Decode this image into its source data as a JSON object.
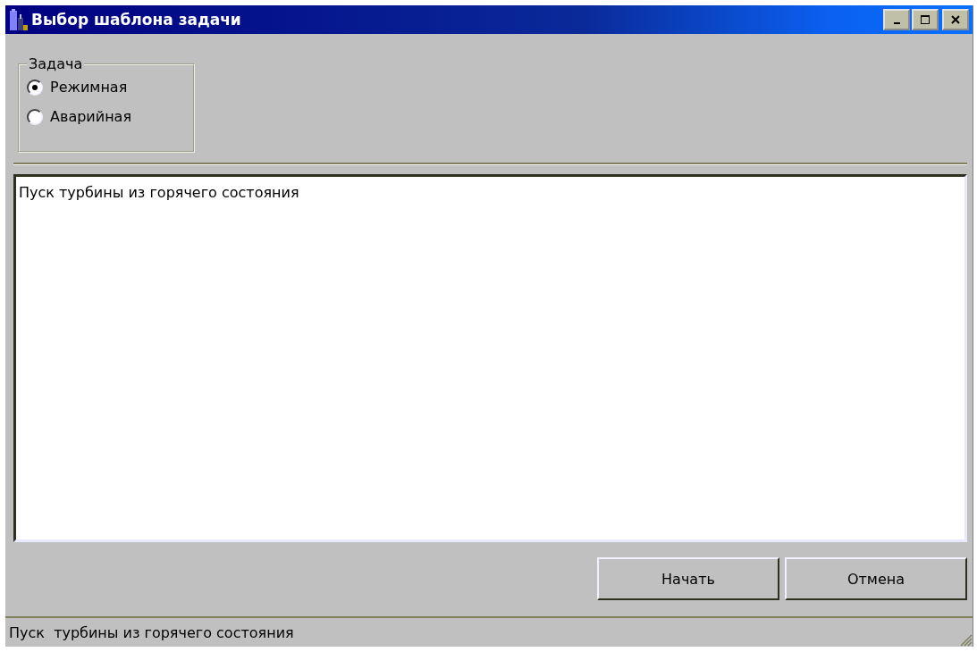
{
  "window": {
    "title": "Выбор шаблона задачи"
  },
  "task_group": {
    "legend": "Задача",
    "options": [
      {
        "label": "Режимная",
        "selected": true
      },
      {
        "label": "Аварийная",
        "selected": false
      }
    ]
  },
  "list": {
    "items": [
      "Пуск турбины из горячего состояния"
    ]
  },
  "buttons": [
    "Начать",
    "Отмена"
  ],
  "status_bar": "Пуск  турбины из горячего состояния"
}
